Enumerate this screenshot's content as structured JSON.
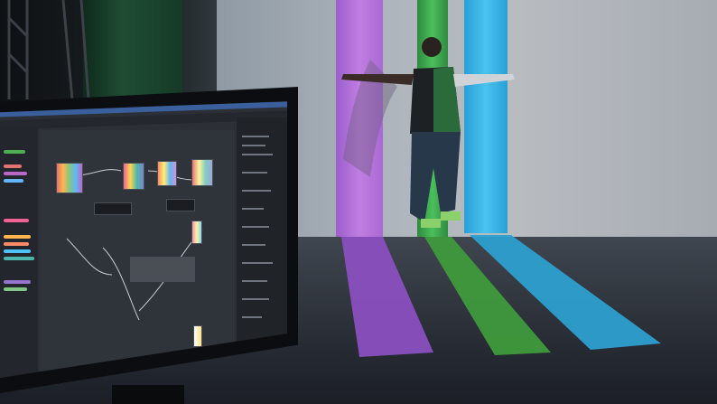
{
  "scene": {
    "description_free": true,
    "beam_colors": {
      "purple": "#b06ad8",
      "green": "#3fae52",
      "cyan": "#3ab5e6",
      "floor_purple": "#8a4fbf",
      "floor_green": "#3f9a3c",
      "floor_cyan": "#2d9fcf"
    }
  },
  "monitor": {
    "accent": "#3a5f9c",
    "sidebar_chip_colors": [
      "#4caf50",
      "#e57373",
      "#ba68c8",
      "#64b5f6",
      "#ffb74d",
      "#4db6ac",
      "#f06292",
      "#9575cd",
      "#81c784",
      "#ff8a65",
      "#4fc3f7",
      "#aed581"
    ]
  }
}
